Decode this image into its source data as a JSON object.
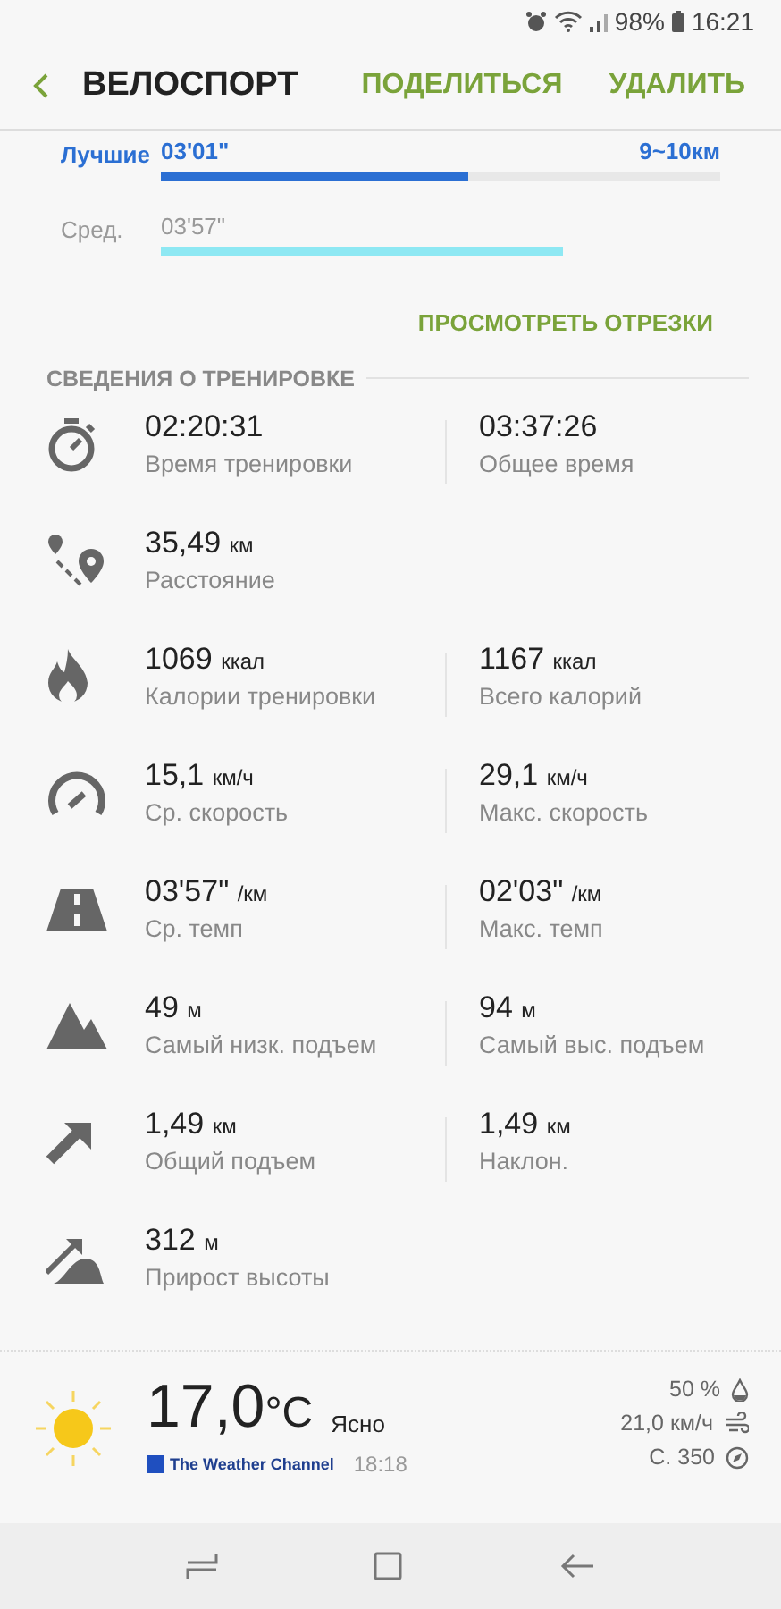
{
  "status_bar": {
    "battery": "98%",
    "time": "16:21"
  },
  "app_bar": {
    "title": "ВЕЛОСПОРТ",
    "actions": [
      "ПОДЕЛИТЬСЯ",
      "УДАЛИТЬ"
    ]
  },
  "pace_bars": [
    {
      "kind": "best",
      "label": "Лучшие",
      "value": "03'01\"",
      "range": "9~10км",
      "level": 0.55
    },
    {
      "kind": "average",
      "label": "Сред.",
      "value": "03'57\"",
      "level": 0.72
    }
  ],
  "segments_link": "ПРОСМОТРЕТЬ ОТРЕЗКИ",
  "section_title": "СВЕДЕНИЯ О ТРЕНИРОВКЕ",
  "stats": [
    {
      "kind": "duration",
      "items": [
        {
          "value": "02:20:31",
          "label": "Время тренировки"
        },
        {
          "value": "03:37:26",
          "label": "Общее время"
        }
      ]
    },
    {
      "kind": "distance",
      "items": [
        {
          "value": "35,49",
          "unit": "км",
          "label": "Расстояние"
        }
      ]
    },
    {
      "kind": "calories",
      "items": [
        {
          "value": "1069",
          "unit": "ккал",
          "label": "Калории тренировки"
        },
        {
          "value": "1167",
          "unit": "ккал",
          "label": "Всего калорий"
        }
      ]
    },
    {
      "kind": "speed",
      "items": [
        {
          "value": "15,1",
          "unit": "км/ч",
          "label": "Ср. скорость"
        },
        {
          "value": "29,1",
          "unit": "км/ч",
          "label": "Макс. скорость"
        }
      ]
    },
    {
      "kind": "pace",
      "items": [
        {
          "value": "03'57\"",
          "unit": "/км",
          "label": "Ср. темп"
        },
        {
          "value": "02'03\"",
          "unit": "/км",
          "label": "Макс. темп"
        }
      ]
    },
    {
      "kind": "altitude",
      "items": [
        {
          "value": "49",
          "unit": "м",
          "label": "Самый низк. подъем"
        },
        {
          "value": "94",
          "unit": "м",
          "label": "Самый выс. подъем"
        }
      ]
    },
    {
      "kind": "ascent",
      "items": [
        {
          "value": "1,49",
          "unit": "км",
          "label": "Общий подъем"
        },
        {
          "value": "1,49",
          "unit": "км",
          "label": "Наклон."
        }
      ]
    },
    {
      "kind": "elevation_gain",
      "items": [
        {
          "value": "312",
          "unit": "м",
          "label": "Прирост высоты"
        }
      ]
    }
  ],
  "weather": {
    "temperature": "17,0",
    "unit": "°C",
    "condition": "Ясно",
    "provider": "The Weather Channel",
    "time": "18:18",
    "details": [
      {
        "kind": "humidity",
        "value": "50 %"
      },
      {
        "kind": "wind",
        "value": "21,0 км/ч"
      },
      {
        "kind": "direction",
        "value": "С. 350"
      }
    ]
  }
}
